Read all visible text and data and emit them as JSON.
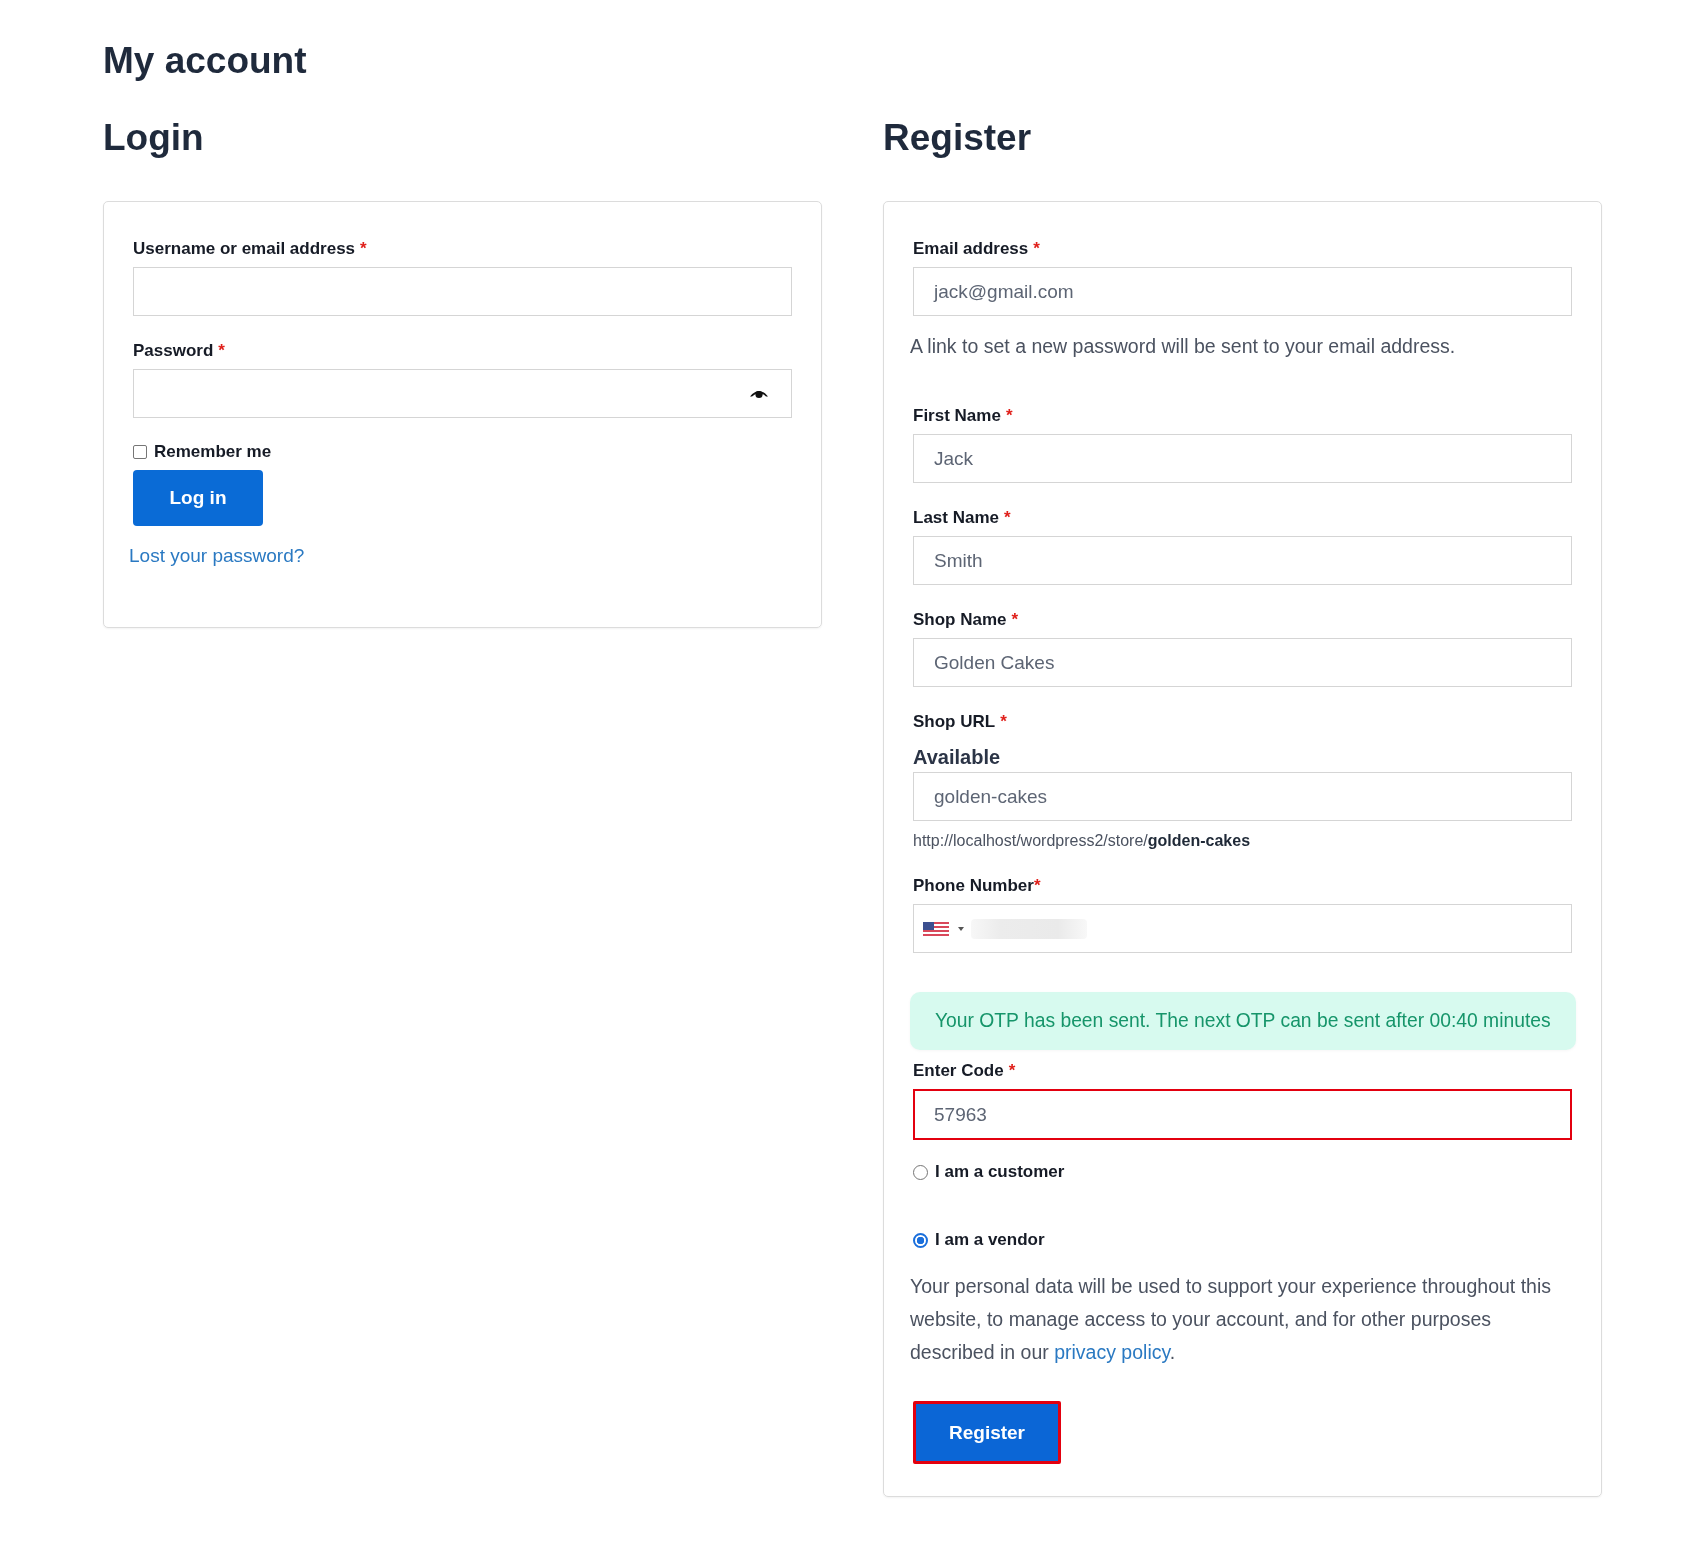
{
  "page": {
    "title": "My account"
  },
  "login": {
    "heading": "Login",
    "fields": [
      {
        "kind": "text",
        "label": "Username or email address",
        "required_mark": "*"
      },
      {
        "kind": "password",
        "label": "Password",
        "required_mark": "*"
      }
    ],
    "remember": {
      "label": "Remember me",
      "checked": false
    },
    "button": {
      "label": "Log in"
    },
    "lost_password_link": "Lost your password?"
  },
  "register": {
    "heading": "Register",
    "items": [
      {
        "kind": "text",
        "label": "Email address",
        "required_mark": "*",
        "value": "jack@gmail.com",
        "hint": "A link to set a new password will be sent to your email address.",
        "highlighted": false
      },
      {
        "kind": "text",
        "label": "First Name",
        "required_mark": "*",
        "value": "Jack",
        "highlighted": false
      },
      {
        "kind": "text",
        "label": "Last Name",
        "required_mark": "*",
        "value": "Smith",
        "highlighted": false
      },
      {
        "kind": "text",
        "label": "Shop Name",
        "required_mark": "*",
        "value": "Golden Cakes",
        "highlighted": false
      },
      {
        "kind": "url",
        "label": "Shop URL",
        "required_mark": "*",
        "status": "Available",
        "value": "golden-cakes",
        "url_preview": "http://localhost/wordpress2/store/**golden-cakes**",
        "highlighted": false
      },
      {
        "kind": "phone",
        "label": "Phone Number",
        "required_mark": "*",
        "highlighted": false
      },
      {
        "kind": "success_notice",
        "text": "Your OTP has been sent. The next OTP can be sent after 00:40 minutes"
      },
      {
        "kind": "text",
        "label": "Enter Code",
        "required_mark": "*",
        "value": "57963",
        "highlighted": true
      }
    ],
    "roles": [
      {
        "label": "I am a customer",
        "selected": false
      },
      {
        "label": "I am a vendor",
        "selected": true
      }
    ],
    "privacy": {
      "text": "Your personal data will be used to support your experience throughout this website, to manage access to your account, and for other purposes described in our ",
      "link": "privacy policy",
      "end": "."
    },
    "button": {
      "label": "Register",
      "highlighted": true
    }
  }
}
